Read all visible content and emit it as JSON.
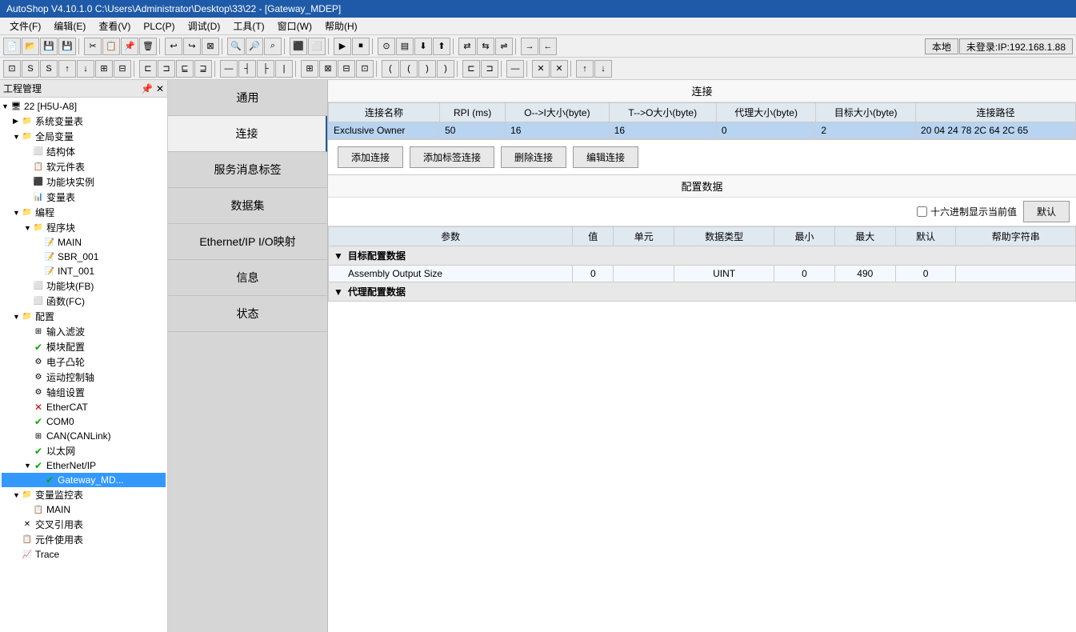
{
  "titleBar": {
    "text": "AutoShop V4.10.1.0  C:\\Users\\Administrator\\Desktop\\33\\22 - [Gateway_MDEP]"
  },
  "menuBar": {
    "items": [
      {
        "label": "文件(F)"
      },
      {
        "label": "编辑(E)"
      },
      {
        "label": "查看(V)"
      },
      {
        "label": "PLC(P)"
      },
      {
        "label": "调试(D)"
      },
      {
        "label": "工具(T)"
      },
      {
        "label": "窗口(W)"
      },
      {
        "label": "帮助(H)"
      }
    ]
  },
  "toolbar2": {
    "localBtn": "本地",
    "loginBtn": "未登录:IP:192.168.1.88"
  },
  "projectPanel": {
    "title": "工程管理",
    "closeBtn": "✕",
    "pinBtn": "📌"
  },
  "navPanel": {
    "items": [
      {
        "label": "通用",
        "active": false
      },
      {
        "label": "连接",
        "active": true
      },
      {
        "label": "服务消息标签",
        "active": false
      },
      {
        "label": "数据集",
        "active": false
      },
      {
        "label": "Ethernet/IP I/O映射",
        "active": false
      },
      {
        "label": "信息",
        "active": false
      },
      {
        "label": "状态",
        "active": false
      }
    ]
  },
  "connectionSection": {
    "header": "连接",
    "tableHeaders": [
      "连接名称",
      "RPI (ms)",
      "O-->I大小(byte)",
      "T-->O大小(byte)",
      "代理大小(byte)",
      "目标大小(byte)",
      "连接路径"
    ],
    "tableRows": [
      {
        "name": "Exclusive Owner",
        "rpi": "50",
        "oi": "16",
        "to": "16",
        "agentSize": "0",
        "targetSize": "2",
        "path": "20 04 24 78 2C 64 2C 65"
      }
    ]
  },
  "buttons": {
    "addConn": "添加连接",
    "addTagConn": "添加标签连接",
    "deleteConn": "删除连接",
    "editConn": "编辑连接"
  },
  "configSection": {
    "header": "配置数据",
    "hexCheckbox": "十六进制显示当前值",
    "defaultBtn": "默认",
    "tableHeaders": [
      "参数",
      "值",
      "单元",
      "数据类型",
      "最小",
      "最大",
      "默认",
      "帮助字符串"
    ],
    "groups": [
      {
        "label": "目标配置数据",
        "expanded": true,
        "rows": [
          {
            "param": "Assembly Output Size",
            "value": "0",
            "unit": "",
            "dataType": "UINT",
            "min": "0",
            "max": "490",
            "default": "0",
            "help": ""
          }
        ]
      },
      {
        "label": "代理配置数据",
        "expanded": true,
        "rows": []
      }
    ]
  },
  "projectTree": {
    "rootLabel": "22 [H5U-A8]",
    "items": [
      {
        "level": 1,
        "label": "系统变量表",
        "type": "folder",
        "expanded": false
      },
      {
        "level": 1,
        "label": "全局变量",
        "type": "folder",
        "expanded": true
      },
      {
        "level": 2,
        "label": "结构体",
        "type": "struct"
      },
      {
        "level": 2,
        "label": "软元件表",
        "type": "table"
      },
      {
        "level": 2,
        "label": "功能块实例",
        "type": "fb-instance"
      },
      {
        "level": 2,
        "label": "变量表",
        "type": "var-table"
      },
      {
        "level": 1,
        "label": "编程",
        "type": "folder",
        "expanded": true
      },
      {
        "level": 2,
        "label": "程序块",
        "type": "folder",
        "expanded": true
      },
      {
        "level": 3,
        "label": "MAIN",
        "type": "program"
      },
      {
        "level": 3,
        "label": "SBR_001",
        "type": "program"
      },
      {
        "level": 3,
        "label": "INT_001",
        "type": "program"
      },
      {
        "level": 2,
        "label": "功能块(FB)",
        "type": "fb"
      },
      {
        "level": 2,
        "label": "函数(FC)",
        "type": "fc"
      },
      {
        "level": 1,
        "label": "配置",
        "type": "folder",
        "expanded": true
      },
      {
        "level": 2,
        "label": "输入滤波",
        "type": "config",
        "status": "none"
      },
      {
        "level": 2,
        "label": "模块配置",
        "type": "config",
        "status": "ok"
      },
      {
        "level": 2,
        "label": "电子凸轮",
        "type": "config",
        "status": "none"
      },
      {
        "level": 2,
        "label": "运动控制轴",
        "type": "config",
        "status": "none"
      },
      {
        "level": 2,
        "label": "轴组设置",
        "type": "config",
        "status": "none"
      },
      {
        "level": 2,
        "label": "EtherCAT",
        "type": "config",
        "status": "err"
      },
      {
        "level": 2,
        "label": "COM0",
        "type": "config",
        "status": "ok"
      },
      {
        "level": 2,
        "label": "CAN(CANLink)",
        "type": "config",
        "status": "none"
      },
      {
        "level": 2,
        "label": "以太网",
        "type": "config",
        "status": "ok"
      },
      {
        "level": 2,
        "label": "EtherNet/IP",
        "type": "folder",
        "expanded": true,
        "status": "ok"
      },
      {
        "level": 3,
        "label": "Gateway_MD...",
        "type": "device",
        "status": "ok",
        "selected": true
      },
      {
        "level": 1,
        "label": "变量监控表",
        "type": "folder",
        "expanded": true
      },
      {
        "level": 2,
        "label": "MAIN",
        "type": "monitor"
      },
      {
        "level": 1,
        "label": "交叉引用表",
        "type": "table"
      },
      {
        "level": 1,
        "label": "元件使用表",
        "type": "table"
      },
      {
        "level": 1,
        "label": "Trace",
        "type": "trace"
      }
    ]
  }
}
